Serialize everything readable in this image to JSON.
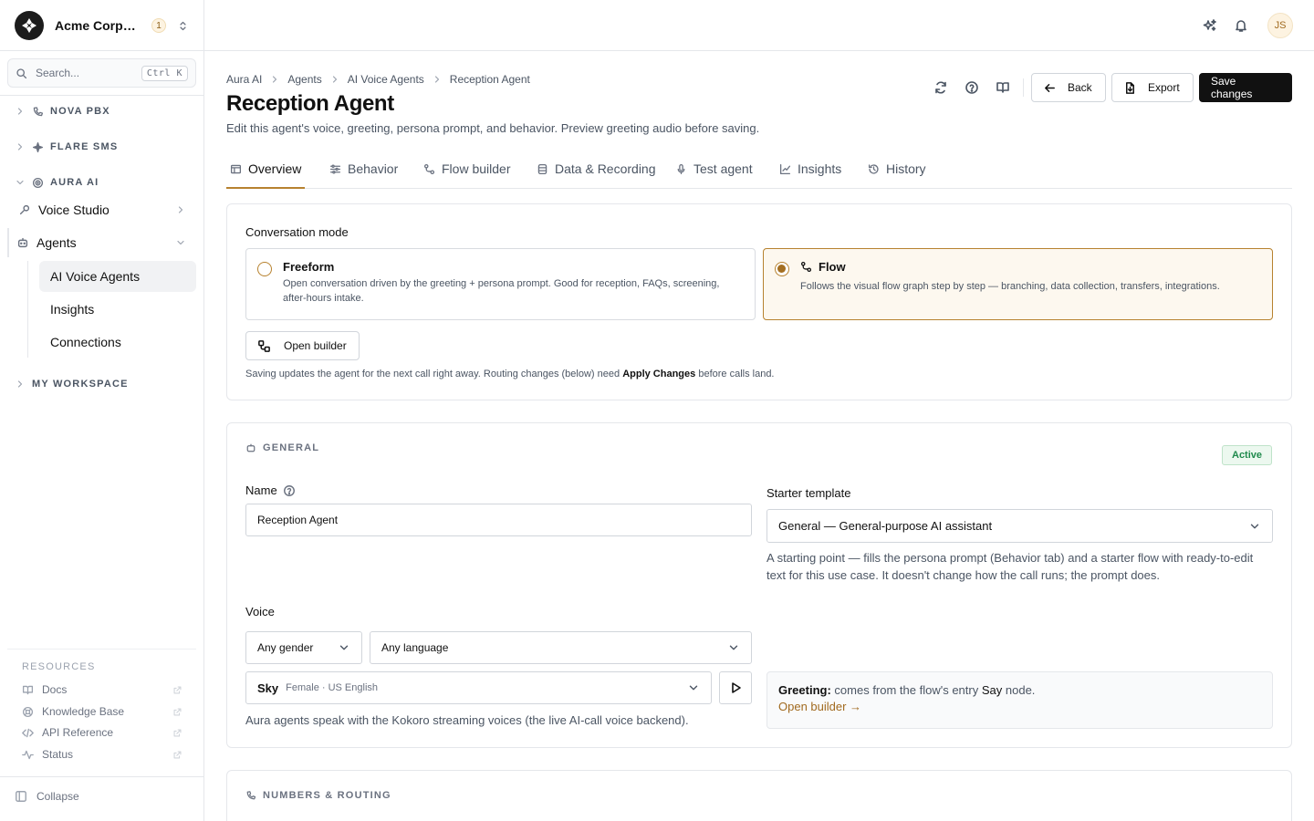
{
  "org": {
    "name": "Acme Corporation",
    "count": "1"
  },
  "search": {
    "placeholder": "Search...",
    "shortcut": "Ctrl K"
  },
  "sidebar": {
    "groups": [
      {
        "label": "NOVA PBX",
        "icon": "phone-icon"
      },
      {
        "label": "FLARE SMS",
        "icon": "sparkle-icon"
      },
      {
        "label": "AURA AI",
        "icon": "radar-icon"
      },
      {
        "label": "MY WORKSPACE"
      }
    ],
    "aura_items": [
      {
        "label": "Voice Studio",
        "icon": "mic-icon"
      },
      {
        "label": "Agents",
        "icon": "bot-icon"
      }
    ],
    "agents_sub": [
      "AI Voice Agents",
      "Insights",
      "Connections"
    ],
    "resources_title": "RESOURCES",
    "resources": [
      {
        "label": "Docs",
        "icon": "book-icon"
      },
      {
        "label": "Knowledge Base",
        "icon": "lifebuoy-icon"
      },
      {
        "label": "API Reference",
        "icon": "code-icon"
      },
      {
        "label": "Status",
        "icon": "activity-icon"
      }
    ],
    "collapse": "Collapse"
  },
  "topbar": {
    "avatar": "JS"
  },
  "breadcrumb": [
    "Aura AI",
    "Agents",
    "AI Voice Agents",
    "Reception Agent"
  ],
  "page": {
    "title": "Reception Agent",
    "subtitle": "Edit this agent's voice, greeting, persona prompt, and behavior. Preview greeting audio before saving."
  },
  "actions": {
    "back": "Back",
    "export": "Export",
    "save": "Save changes"
  },
  "tabs": [
    {
      "label": "Overview",
      "icon": "layout-icon",
      "active": true
    },
    {
      "label": "Behavior",
      "icon": "sliders-icon"
    },
    {
      "label": "Flow builder",
      "icon": "flow-icon"
    },
    {
      "label": "Data & Recording",
      "icon": "database-icon"
    },
    {
      "label": "Test agent",
      "icon": "mic-icon"
    },
    {
      "label": "Insights",
      "icon": "chart-icon"
    },
    {
      "label": "History",
      "icon": "history-icon"
    }
  ],
  "conversation": {
    "label": "Conversation mode",
    "freeform": {
      "title": "Freeform",
      "desc": "Open conversation driven by the greeting + persona prompt. Good for reception, FAQs, screening, after-hours intake."
    },
    "flow": {
      "title": "Flow",
      "desc": "Follows the visual flow graph step by step — branching, data collection, transfers, integrations.",
      "selected": true
    },
    "open_builder": "Open builder",
    "note_pre": "Saving updates the agent for the next call right away. Routing changes (below) need",
    "note_strong": "Apply Changes",
    "note_post": "before calls land."
  },
  "general": {
    "heading": "GENERAL",
    "status": "Active",
    "name_label": "Name",
    "name_value": "Reception Agent",
    "template_label": "Starter template",
    "template_value": "General — General-purpose AI assistant",
    "template_help": "A starting point — fills the persona prompt (Behavior tab) and a starter flow with ready-to-edit text for this use case. It doesn't change how the call runs; the prompt does.",
    "voice_label": "Voice",
    "gender": "Any gender",
    "language": "Any language",
    "voice_name": "Sky",
    "voice_meta": "Female · US English",
    "voice_help": "Aura agents speak with the Kokoro streaming voices (the live AI-call voice backend).",
    "greeting_label": "Greeting:",
    "greeting_pre": "comes from the flow's entry",
    "greeting_node": "Say",
    "greeting_post": "node.",
    "greeting_link": "Open builder →"
  },
  "numbers": {
    "heading": "NUMBERS & ROUTING"
  },
  "colors": {
    "accent": "#b7822f",
    "primary": "#111111",
    "active_badge": "#1f8a4c"
  }
}
